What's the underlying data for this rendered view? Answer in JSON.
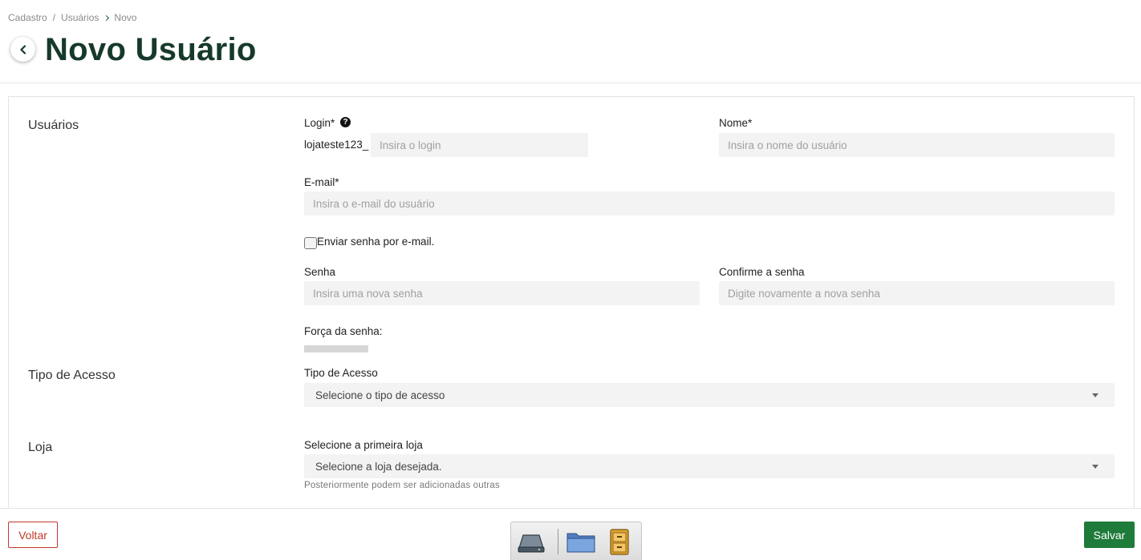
{
  "breadcrumb": {
    "item1": "Cadastro",
    "separator": "/",
    "item2": "Usuários",
    "item3": "Novo"
  },
  "page": {
    "title": "Novo Usuário"
  },
  "sections": {
    "usuarios": "Usuários",
    "tipo_acesso": "Tipo de Acesso",
    "loja": "Loja"
  },
  "form": {
    "login_label": "Login*",
    "login_prefix": "lojateste123_",
    "login_placeholder": "Insira o login",
    "nome_label": "Nome*",
    "nome_placeholder": "Insira o nome do usuário",
    "email_label": "E-mail*",
    "email_placeholder": "Insira o e-mail do usuário",
    "send_password_label": "Enviar senha por e-mail.",
    "senha_label": "Senha",
    "senha_placeholder": "Insira uma nova senha",
    "confirm_label": "Confirme a senha",
    "confirm_placeholder": "Digite novamente a nova senha",
    "strength_label": "Força da senha:",
    "tipo_acesso_label": "Tipo de Acesso",
    "tipo_acesso_selected": "Selecione o tipo de acesso",
    "loja_label": "Selecione a primeira loja",
    "loja_selected": "Selecione a loja desejada.",
    "loja_hint": "Posteriormente podem ser adicionadas outras"
  },
  "footer": {
    "voltar_label": "Voltar",
    "salvar_label": "Salvar"
  },
  "dock": {
    "icons": [
      "drive-icon",
      "folder-icon",
      "file-cabinet-icon"
    ]
  },
  "colors": {
    "primary": "#1e7b3a",
    "title": "#163a2a",
    "danger": "#c0392b",
    "input_bg": "#f3f3f3"
  }
}
